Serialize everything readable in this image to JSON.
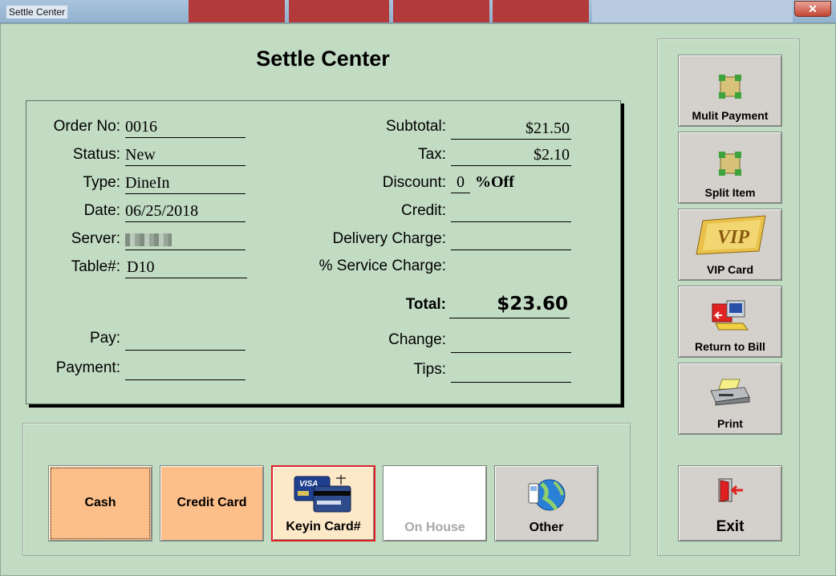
{
  "window": {
    "title": "Settle Center"
  },
  "heading": "Settle Center",
  "order": {
    "order_no_label": "Order No:",
    "order_no": "0016",
    "status_label": "Status:",
    "status": "New",
    "type_label": "Type:",
    "type": "DineIn",
    "date_label": "Date:",
    "date": "06/25/2018",
    "server_label": "Server:",
    "table_label": "Table#:",
    "table": "D10",
    "pay_label": "Pay:",
    "pay": "",
    "payment_label": "Payment:",
    "payment": ""
  },
  "totals": {
    "subtotal_label": "Subtotal:",
    "subtotal": "$21.50",
    "tax_label": "Tax:",
    "tax": "$2.10",
    "discount_label": "Discount:",
    "discount": "0",
    "discount_unit": "%Off",
    "credit_label": "Credit:",
    "credit": "",
    "delivery_label": "Delivery Charge:",
    "delivery": "",
    "service_label": "% Service Charge:",
    "total_label": "Total:",
    "total": "$23.60",
    "change_label": "Change:",
    "change": "",
    "tips_label": "Tips:",
    "tips": ""
  },
  "payment_buttons": {
    "cash": "Cash",
    "credit_card": "Credit Card",
    "keyin_card": "Keyin Card#",
    "on_house": "On House",
    "other": "Other"
  },
  "side_buttons": {
    "multi_payment": "Mulit Payment",
    "split_item": "Split Item",
    "vip_card": "VIP Card",
    "return_to_bill": "Return to Bill",
    "print": "Print",
    "exit": "Exit"
  },
  "colors": {
    "background": "#c2dbc3",
    "cash_button": "#fdbf8a",
    "keyin_button": "#fde8c8",
    "keyin_border": "#e02020",
    "side_button": "#d4d0cb"
  }
}
